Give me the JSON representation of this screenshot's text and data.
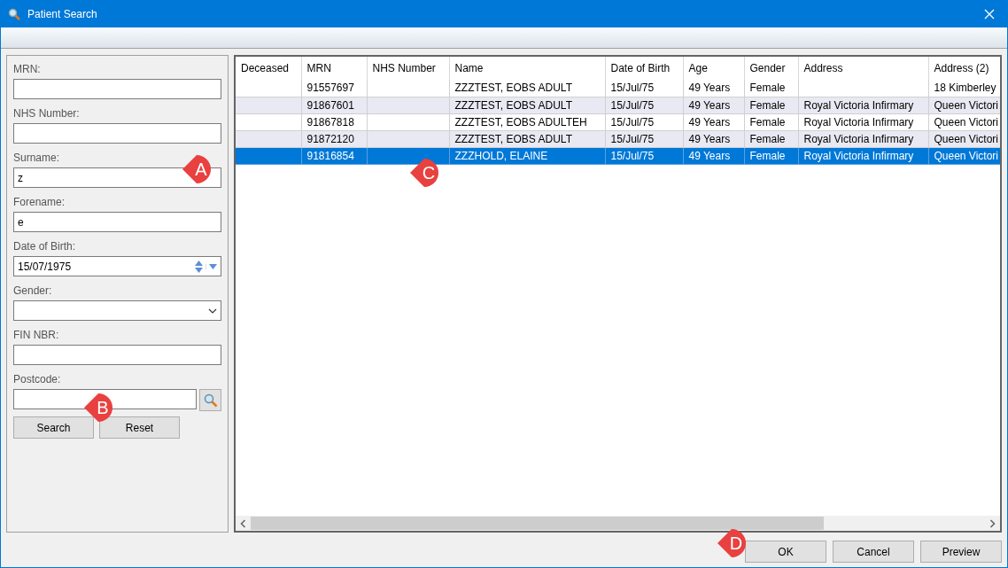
{
  "window": {
    "title": "Patient Search"
  },
  "form": {
    "fields": [
      {
        "kind": "text",
        "label": "MRN:"
      },
      {
        "kind": "text",
        "label": "NHS Number:"
      },
      {
        "kind": "text",
        "label": "Surname:",
        "value": "z"
      },
      {
        "kind": "text",
        "label": "Forename:",
        "value": "e"
      },
      {
        "kind": "date",
        "label": "Date of Birth:",
        "value": "15/07/1975"
      },
      {
        "kind": "select",
        "label": "Gender:"
      },
      {
        "kind": "text",
        "label": "FIN NBR:"
      },
      {
        "kind": "lookup",
        "label": "Postcode:"
      }
    ],
    "buttons": [
      "Search",
      "Reset"
    ]
  },
  "table": {
    "columns": [
      "Deceased",
      "MRN",
      "NHS Number",
      "Name",
      "Date of Birth",
      "Age",
      "Gender",
      "Address",
      "Address (2)"
    ],
    "rows": [
      {
        "selected": false,
        "cells": [
          "",
          "91557697",
          "",
          "ZZZTEST, EOBS ADULT",
          "15/Jul/75",
          "49 Years",
          "Female",
          "",
          "18 Kimberley"
        ]
      },
      {
        "selected": false,
        "cells": [
          "",
          "91867601",
          "",
          "ZZZTEST, EOBS ADULT",
          "15/Jul/75",
          "49 Years",
          "Female",
          "Royal Victoria Infirmary",
          "Queen Victori"
        ]
      },
      {
        "selected": false,
        "cells": [
          "",
          "91867818",
          "",
          "ZZZTEST, EOBS ADULTEH",
          "15/Jul/75",
          "49 Years",
          "Female",
          "Royal Victoria Infirmary",
          "Queen Victori"
        ]
      },
      {
        "selected": false,
        "cells": [
          "",
          "91872120",
          "",
          "ZZZTEST, EOBS ADULT",
          "15/Jul/75",
          "49 Years",
          "Female",
          "Royal Victoria Infirmary",
          "Queen Victori"
        ]
      },
      {
        "selected": true,
        "cells": [
          "",
          "91816854",
          "",
          "ZZZHOLD, ELAINE",
          "15/Jul/75",
          "49 Years",
          "Female",
          "Royal Victoria Infirmary",
          "Queen Victori"
        ]
      }
    ]
  },
  "buttons": [
    "OK",
    "Cancel",
    "Preview"
  ],
  "annotations": [
    {
      "label": "A"
    },
    {
      "label": "B"
    },
    {
      "label": "C"
    },
    {
      "label": "D"
    }
  ]
}
